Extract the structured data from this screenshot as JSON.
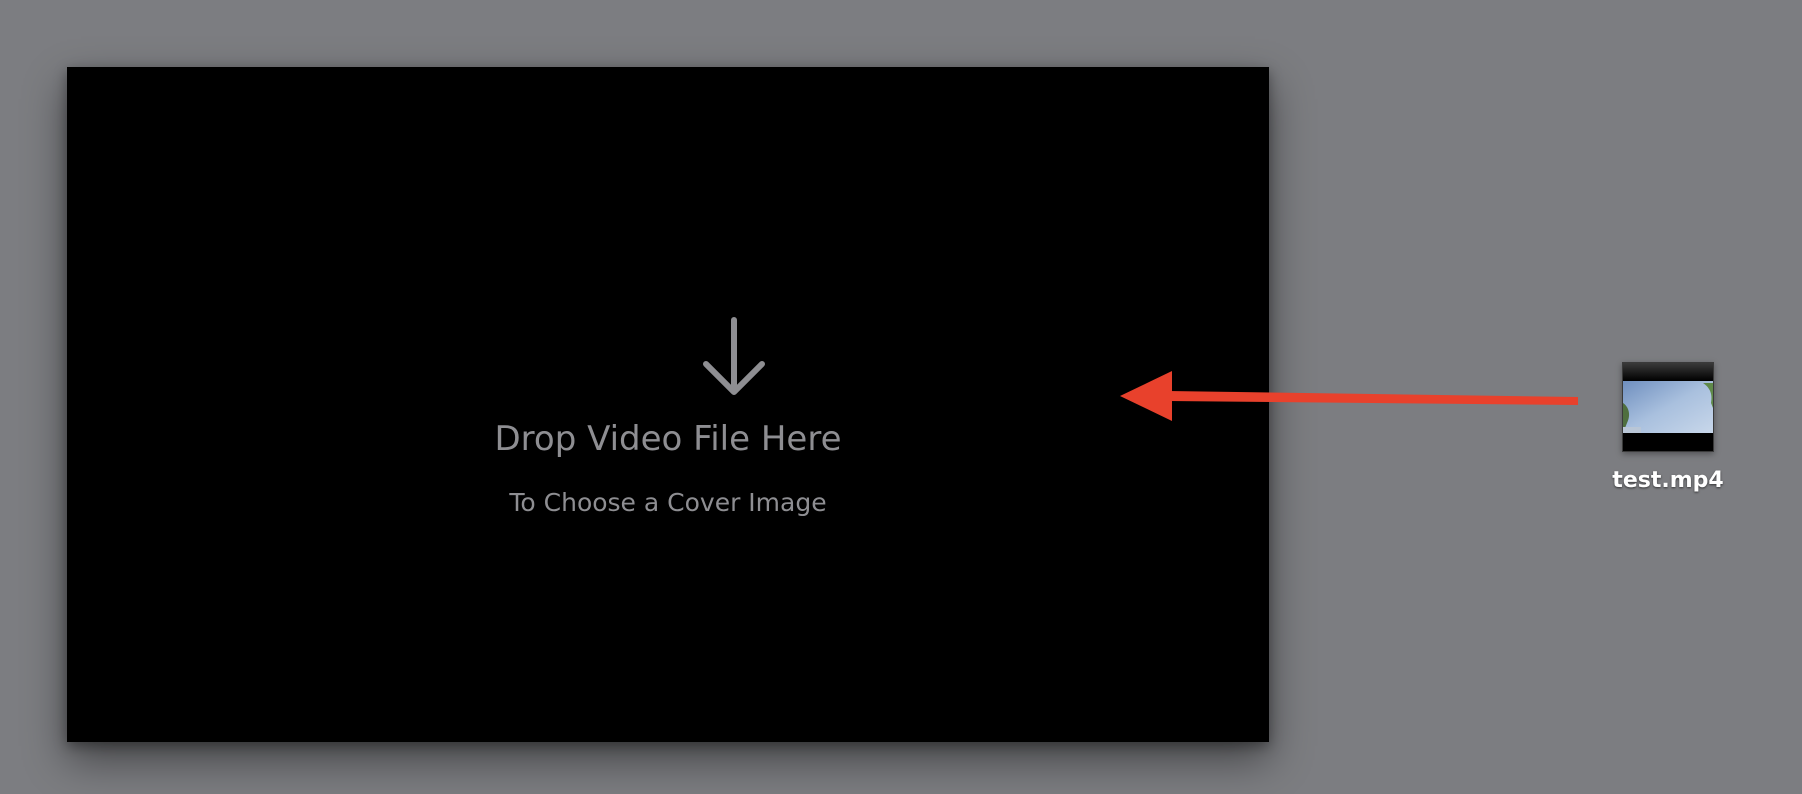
{
  "drop_zone": {
    "icon": "down-arrow-icon",
    "title": "Drop Video File Here",
    "subtitle": "To Choose a Cover Image"
  },
  "annotation": {
    "icon": "left-arrow-icon",
    "color": "#e8412c"
  },
  "file": {
    "icon": "video-file-thumbnail",
    "name": "test.mp4"
  },
  "colors": {
    "desktop": "#7c7d81",
    "window": "#000000",
    "text": "#8e8e92"
  }
}
